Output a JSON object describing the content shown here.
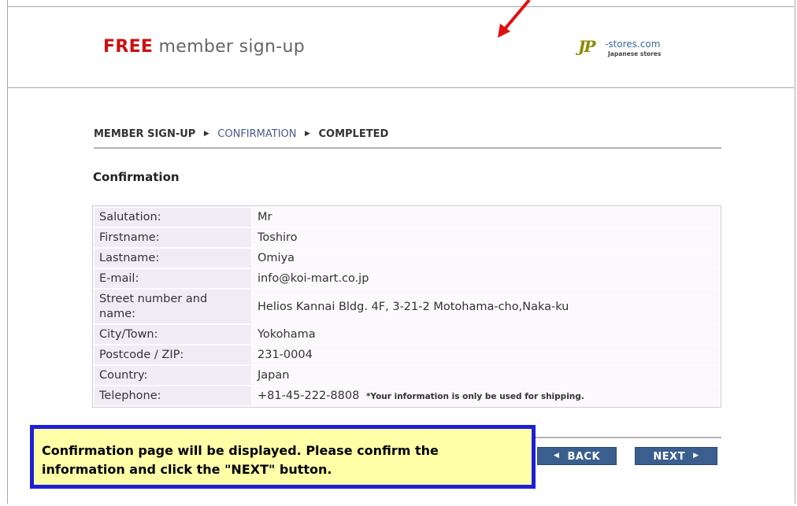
{
  "header": {
    "title_free": "FREE",
    "title_rest": "member sign-up",
    "logo_mark": "JP",
    "logo_domain": "-stores.com",
    "logo_sub": "Japanese stores"
  },
  "breadcrumb": {
    "steps": [
      "MEMBER SIGN-UP",
      "CONFIRMATION",
      "COMPLETED"
    ],
    "active": "CONFIRMATION",
    "separator": "▶"
  },
  "section_title": "Confirmation",
  "rows": [
    {
      "label": "Salutation:",
      "value": "Mr"
    },
    {
      "label": "Firstname:",
      "value": "Toshiro"
    },
    {
      "label": "Lastname:",
      "value": "Omiya"
    },
    {
      "label": "E-mail:",
      "value": "info@koi-mart.co.jp"
    },
    {
      "label": "Street number and name:",
      "value": "Helios Kannai Bldg. 4F, 3-21-2 Motohama-cho,Naka-ku"
    },
    {
      "label": "City/Town:",
      "value": "Yokohama"
    },
    {
      "label": "Postcode / ZIP:",
      "value": "231-0004"
    },
    {
      "label": "Country:",
      "value": "Japan"
    },
    {
      "label": "Telephone:",
      "value": "+81-45-222-8808"
    }
  ],
  "telephone_note": "*Your information is only be used for shipping.",
  "buttons": {
    "back_label": "BACK",
    "next_label": "NEXT"
  },
  "callout_text": "Confirmation page will be displayed. Please confirm the information and click the \"NEXT\" button.",
  "colors": {
    "accent_red": "#cc1111",
    "button_blue": "#3a5f8f",
    "callout_border": "#1f1fd6",
    "callout_bg": "#ffffa8",
    "annotation_arrow": "#e01010"
  }
}
